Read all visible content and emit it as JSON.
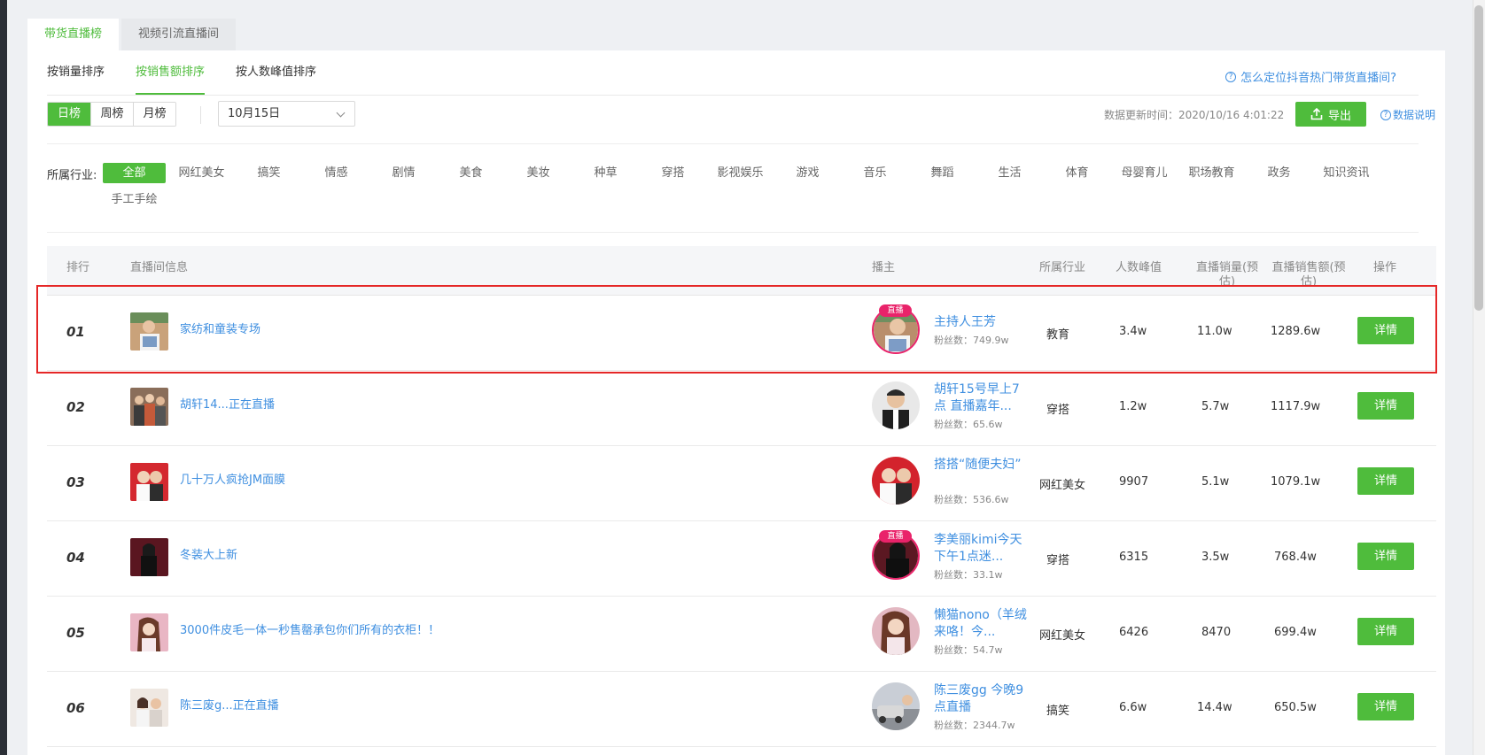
{
  "top_tabs": [
    {
      "label": "带货直播榜",
      "active": true
    },
    {
      "label": "视频引流直播间",
      "active": false
    }
  ],
  "sub_tabs": [
    {
      "label": "按销量排序",
      "active": false
    },
    {
      "label": "按销售额排序",
      "active": true
    },
    {
      "label": "按人数峰值排序",
      "active": false
    }
  ],
  "help_link": "怎么定位抖音热门带货直播间?",
  "period_buttons": [
    {
      "label": "日榜",
      "active": true
    },
    {
      "label": "周榜",
      "active": false
    },
    {
      "label": "月榜",
      "active": false
    }
  ],
  "date_select": {
    "value": "10月15日"
  },
  "update_time": "数据更新时间：2020/10/16 4:01:22",
  "export_label": "导出",
  "data_note": "数据说明",
  "industry": {
    "label": "所属行业:",
    "items": [
      "全部",
      "网红美女",
      "搞笑",
      "情感",
      "剧情",
      "美食",
      "美妆",
      "种草",
      "穿搭",
      "影视娱乐",
      "游戏",
      "音乐",
      "舞蹈",
      "生活",
      "体育",
      "母婴育儿",
      "职场教育",
      "政务",
      "知识资讯",
      "手工手绘"
    ],
    "active": "全部"
  },
  "table": {
    "headers": {
      "rank": "排行",
      "room": "直播间信息",
      "host": "播主",
      "industry": "所属行业",
      "peak": "人数峰值",
      "volume_line1": "直播销量(预",
      "volume_line2": "估)",
      "sales_line1": "直播销售额(预",
      "sales_line2": "估)",
      "action": "操作"
    },
    "detail_label": "详情",
    "live_badge": "直播",
    "rows": [
      {
        "rank": "01",
        "title": "家纺和童装专场",
        "host": "主持人王芳",
        "fans": "粉丝数：749.9w",
        "industry": "教育",
        "peak": "3.4w",
        "volume": "11.0w",
        "sales": "1289.6w",
        "live": true
      },
      {
        "rank": "02",
        "title": "胡轩14...正在直播",
        "host": "胡轩15号早上7点 直播嘉年...",
        "fans": "粉丝数：65.6w",
        "industry": "穿搭",
        "peak": "1.2w",
        "volume": "5.7w",
        "sales": "1117.9w",
        "live": false
      },
      {
        "rank": "03",
        "title": "几十万人疯抢JM面膜",
        "host": "搭搭“随便夫妇”",
        "fans": "粉丝数：536.6w",
        "industry": "网红美女",
        "peak": "9907",
        "volume": "5.1w",
        "sales": "1079.1w",
        "live": false
      },
      {
        "rank": "04",
        "title": "冬装大上新",
        "host": "李美丽kimi今天下午1点迷...",
        "fans": "粉丝数：33.1w",
        "industry": "穿搭",
        "peak": "6315",
        "volume": "3.5w",
        "sales": "768.4w",
        "live": true
      },
      {
        "rank": "05",
        "title": "3000件皮毛一体一秒售罄承包你们所有的衣柜！！",
        "host": "懒猫nono（羊绒来咯！今...",
        "fans": "粉丝数：54.7w",
        "industry": "网红美女",
        "peak": "6426",
        "volume": "8470",
        "sales": "699.4w",
        "live": false
      },
      {
        "rank": "06",
        "title": "陈三废g...正在直播",
        "host": "陈三废gg 今晚9点直播",
        "fans": "粉丝数：2344.7w",
        "industry": "搞笑",
        "peak": "6.6w",
        "volume": "14.4w",
        "sales": "650.5w",
        "live": false
      }
    ]
  }
}
